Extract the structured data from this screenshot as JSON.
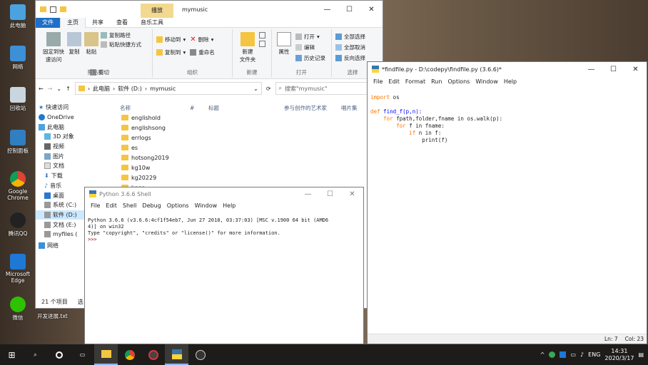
{
  "desktop": {
    "icons": [
      "此电脑",
      "网络",
      "回收站",
      "控制面板",
      "Google Chrome",
      "腾讯QQ",
      "Microsoft Edge",
      "微信"
    ],
    "file_label": "开发进展.txt"
  },
  "explorer": {
    "title": "mymusic",
    "contextual_tab": "播放",
    "tabs": [
      "文件",
      "主页",
      "共享",
      "查看",
      "音乐工具"
    ],
    "ribbon": {
      "clipboard": {
        "pin": "固定到快速访问",
        "copy": "复制",
        "paste": "粘贴",
        "copy_path": "复制路径",
        "paste_shortcut": "粘贴快捷方式",
        "cut": "剪切",
        "group": "剪贴板"
      },
      "organize": {
        "move_to": "移动到",
        "delete": "删除",
        "copy_to": "复制到",
        "rename": "重命名",
        "group": "组织"
      },
      "new": {
        "new_folder": "新建\n文件夹",
        "group": "新建"
      },
      "open": {
        "properties": "属性",
        "open": "打开",
        "edit": "编辑",
        "history": "历史记录",
        "group": "打开"
      },
      "select": {
        "all": "全部选择",
        "none": "全部取消",
        "invert": "反向选择",
        "group": "选择"
      }
    },
    "address": {
      "path": [
        "此电脑",
        "软件 (D:)",
        "mymusic"
      ],
      "search_placeholder": "搜索\"mymusic\""
    },
    "nav": [
      "快速访问",
      "OneDrive",
      "此电脑",
      "3D 对象",
      "视频",
      "图片",
      "文档",
      "下载",
      "音乐",
      "桌面",
      "系统 (C:)",
      "软件 (D:)",
      "文档 (E:)",
      "myfiles (",
      "网络"
    ],
    "columns": [
      "名称",
      "#",
      "标题",
      "参与创作的艺术家",
      "唱片集"
    ],
    "files": [
      "englishold",
      "englishsong",
      "errlogs",
      "es",
      "hotsong2019",
      "kg10w",
      "kg20229",
      "kges"
    ],
    "status": "21 个项目",
    "status_extra": "选"
  },
  "editor": {
    "title": "*findfile.py - D:\\codepy\\findfile.py (3.6.6)*",
    "menu": [
      "File",
      "Edit",
      "Format",
      "Run",
      "Options",
      "Window",
      "Help"
    ],
    "code": [
      {
        "kw": "import",
        "rest": " os"
      },
      {
        "kw": "",
        "rest": ""
      },
      {
        "kw": "def",
        "rest": " find_f(p,n):"
      },
      {
        "kw": "    for",
        "rest": " fpath,folder,fname in os.walk(p):"
      },
      {
        "kw": "        for",
        "rest": " f in fname:"
      },
      {
        "kw": "            if",
        "rest": " n in f:"
      },
      {
        "kw": "",
        "rest": "                print(f)"
      }
    ],
    "status_ln": "Ln: 7",
    "status_col": "Col: 23"
  },
  "shell": {
    "title": "Python 3.6.6 Shell",
    "menu": [
      "File",
      "Edit",
      "Shell",
      "Debug",
      "Options",
      "Window",
      "Help"
    ],
    "banner1": "Python 3.6.6 (v3.6.6:4cf1f54eb7, Jun 27 2018, 03:37:03) [MSC v.1900 64 bit (AMD6",
    "banner2": "4)] on win32",
    "banner3": "Type \"copyright\", \"credits\" or \"license()\" for more information.",
    "prompt": ">>> "
  },
  "taskbar": {
    "lang": "ENG",
    "time": "14:31",
    "date": "2020/3/17"
  }
}
